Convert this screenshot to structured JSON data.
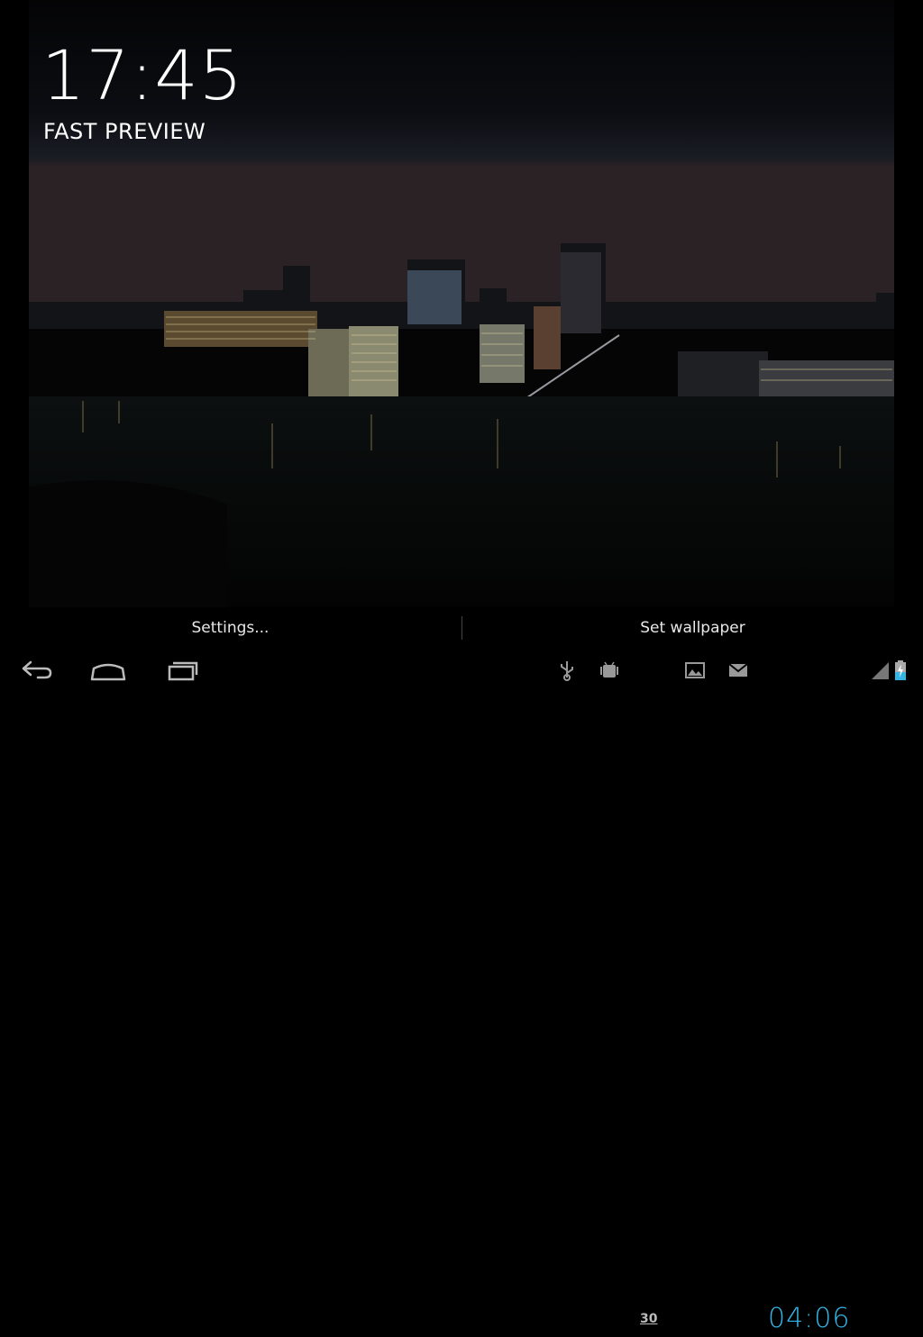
{
  "preview": {
    "clock_time": "17:45",
    "label": "FAST PREVIEW"
  },
  "actions": {
    "settings_label": "Settings...",
    "set_wallpaper_label": "Set wallpaper"
  },
  "status_bar": {
    "time": "04:06",
    "notification_30_text": "30",
    "icons": [
      "usb-icon",
      "android-debug-icon",
      "calendar-30-icon",
      "gallery-icon",
      "gmail-icon",
      "signal-icon",
      "battery-charging-icon"
    ]
  },
  "navigation": {
    "icons": [
      "back-icon",
      "home-icon",
      "recent-apps-icon"
    ]
  },
  "colors": {
    "accent_blue": "#33b5e5",
    "background": "#000000"
  }
}
